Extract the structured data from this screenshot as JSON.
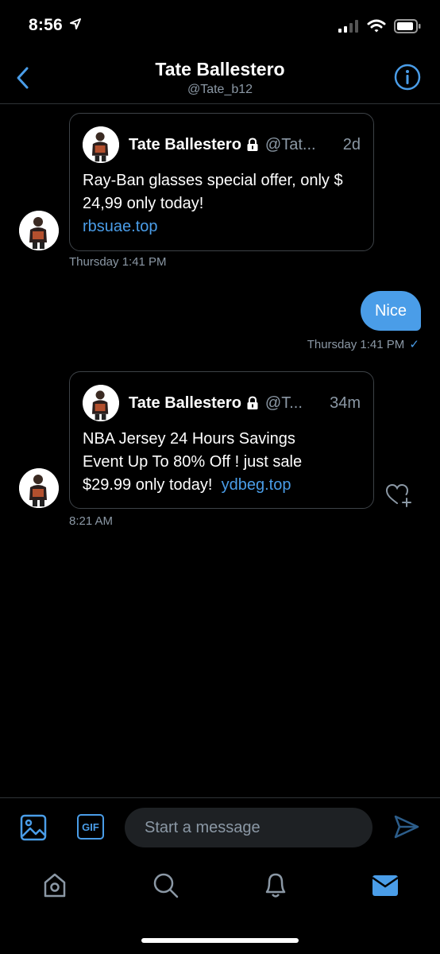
{
  "status_bar": {
    "time": "8:56"
  },
  "header": {
    "name": "Tate Ballestero",
    "handle": "@Tate_b12"
  },
  "messages": [
    {
      "card": {
        "name": "Tate Ballestero",
        "handle": "@Tat...",
        "age": "2d",
        "text": "Ray-Ban glasses special offer, only $ 24,99 only today!",
        "link": "rbsuae.top"
      },
      "time": "Thursday 1:41 PM"
    },
    {
      "sent_text": "Nice",
      "time": "Thursday 1:41 PM",
      "check": "✓"
    },
    {
      "card": {
        "name": "Tate Ballestero",
        "handle": "@T...",
        "age": "34m",
        "text_line1": "NBA Jersey 24 Hours Savings",
        "text_line2": "Event Up To 80% Off ! just sale",
        "text_line3": "$29.99 only today!",
        "link": "ydbeg.top"
      },
      "time": "8:21 AM"
    }
  ],
  "composer": {
    "gif_label": "GIF",
    "placeholder": "Start a message"
  },
  "icons": {
    "back": "chevron-left-icon",
    "info": "info-icon",
    "lock": "lock-icon",
    "like": "heart-plus-icon",
    "image": "image-icon",
    "gif": "gif-icon",
    "send": "send-icon",
    "home": "home-icon",
    "search": "search-icon",
    "notifications": "bell-icon",
    "messages": "mail-icon"
  },
  "colors": {
    "accent": "#4a9de8",
    "background": "#000000",
    "muted": "#8b98a5"
  }
}
